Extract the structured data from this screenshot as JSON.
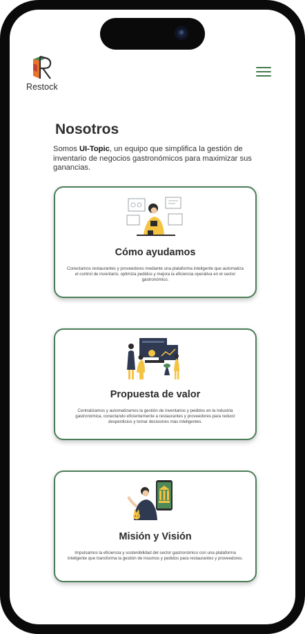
{
  "brand": {
    "name": "Restock"
  },
  "page": {
    "title": "Nosotros",
    "intro_prefix": "Somos ",
    "intro_bold": "UI-Topic",
    "intro_rest": ", un equipo que simplifica la gestión de inventario de negocios gastronómicos para maximizar sus ganancias."
  },
  "cards": [
    {
      "title": "Cómo ayudamos",
      "text": "Conectamos restaurantes y proveedores mediante una plataforma inteligente que automatiza el control de inventario, optimiza pedidos y mejora la eficiencia operativa en el sector gastronómico.",
      "icon": "woman-at-desk-illustration"
    },
    {
      "title": "Propuesta de valor",
      "text": "Centralizamos y automatizamos la gestión de inventarios y pedidos en la industria gastronómica, conectando eficientemente a restaurantes y proveedores para reducir desperdicios y tomar decisiones más inteligentes.",
      "icon": "team-dashboard-illustration"
    },
    {
      "title": "Misión y Visión",
      "text": "Impulsamos la eficiencia y sostenibilidad del sector gastronómico con una plataforma inteligente que transforma la gestión de insumos y pedidos para restaurantes y proveedores.",
      "icon": "person-bank-phone-illustration"
    }
  ],
  "colors": {
    "accent": "#4a7d57",
    "logo_orange": "#e8742f",
    "logo_green": "#4e8a57",
    "illustration_yellow": "#f5c342"
  }
}
